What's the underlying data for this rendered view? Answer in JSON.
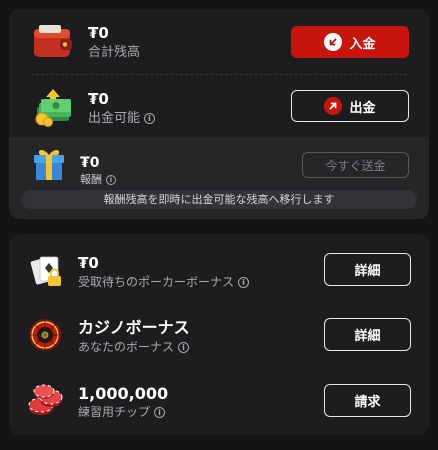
{
  "wallet": {
    "total": {
      "amount": "₮0",
      "label": "合計残高",
      "icon": "wallet-icon"
    },
    "deposit_label": "入金",
    "withdrawable": {
      "amount": "₮0",
      "label": "出金可能",
      "icon": "money-stack-icon"
    },
    "withdraw_label": "出金",
    "reward": {
      "amount": "₮0",
      "label": "報酬",
      "icon": "gift-box-icon"
    },
    "send_now_label": "今すぐ送金",
    "banner_text": "報酬残高を即時に出金可能な残高へ移行します"
  },
  "bonuses": [
    {
      "title": "₮0",
      "subtitle": "受取待ちのポーカーボーナス",
      "button": "詳細",
      "icon": "locked-cards-icon"
    },
    {
      "title": "カジノボーナス",
      "subtitle": "あなたのボーナス",
      "button": "詳細",
      "icon": "roulette-icon"
    },
    {
      "title": "1,000,000",
      "subtitle": "練習用チップ",
      "button": "請求",
      "icon": "poker-chips-icon"
    }
  ],
  "colors": {
    "accent": "#c8140d",
    "card": "#1d1d20",
    "background": "#141416"
  }
}
